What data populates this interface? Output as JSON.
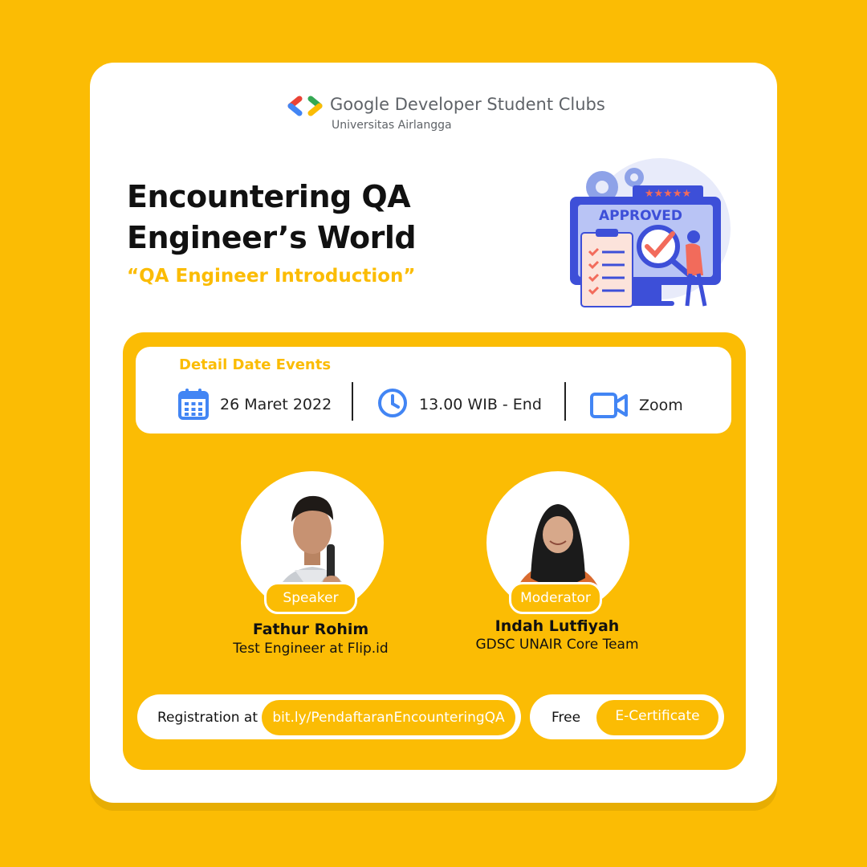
{
  "brand": {
    "name": "Google Developer Student Clubs",
    "chapter": "Universitas Airlangga"
  },
  "event": {
    "title": "Encountering QA Engineer’s World",
    "subtitle": "“QA Engineer Introduction”",
    "illustration_label": "APPROVED"
  },
  "details": {
    "heading": "Detail Date Events",
    "date": "26 Maret 2022",
    "time": "13.00 WIB - End",
    "platform": "Zoom",
    "icons": [
      "calendar-icon",
      "clock-icon",
      "video-camera-icon"
    ]
  },
  "people": [
    {
      "role": "Speaker",
      "name": "Fathur Rohim",
      "title": "Test Engineer at Flip.id"
    },
    {
      "role": "Moderator",
      "name": "Indah Lutfiyah",
      "title": "GDSC UNAIR Core Team"
    }
  ],
  "registration": {
    "label": "Registration at",
    "link": "bit.ly/PendaftaranEncounteringQA"
  },
  "benefit": {
    "label": "Free",
    "item": "E-Certificate"
  },
  "colors": {
    "background": "#FBBC04",
    "card": "#FFFFFF",
    "accent": "#FBBC04",
    "icon_blue": "#4285F4",
    "text": "#111111"
  }
}
